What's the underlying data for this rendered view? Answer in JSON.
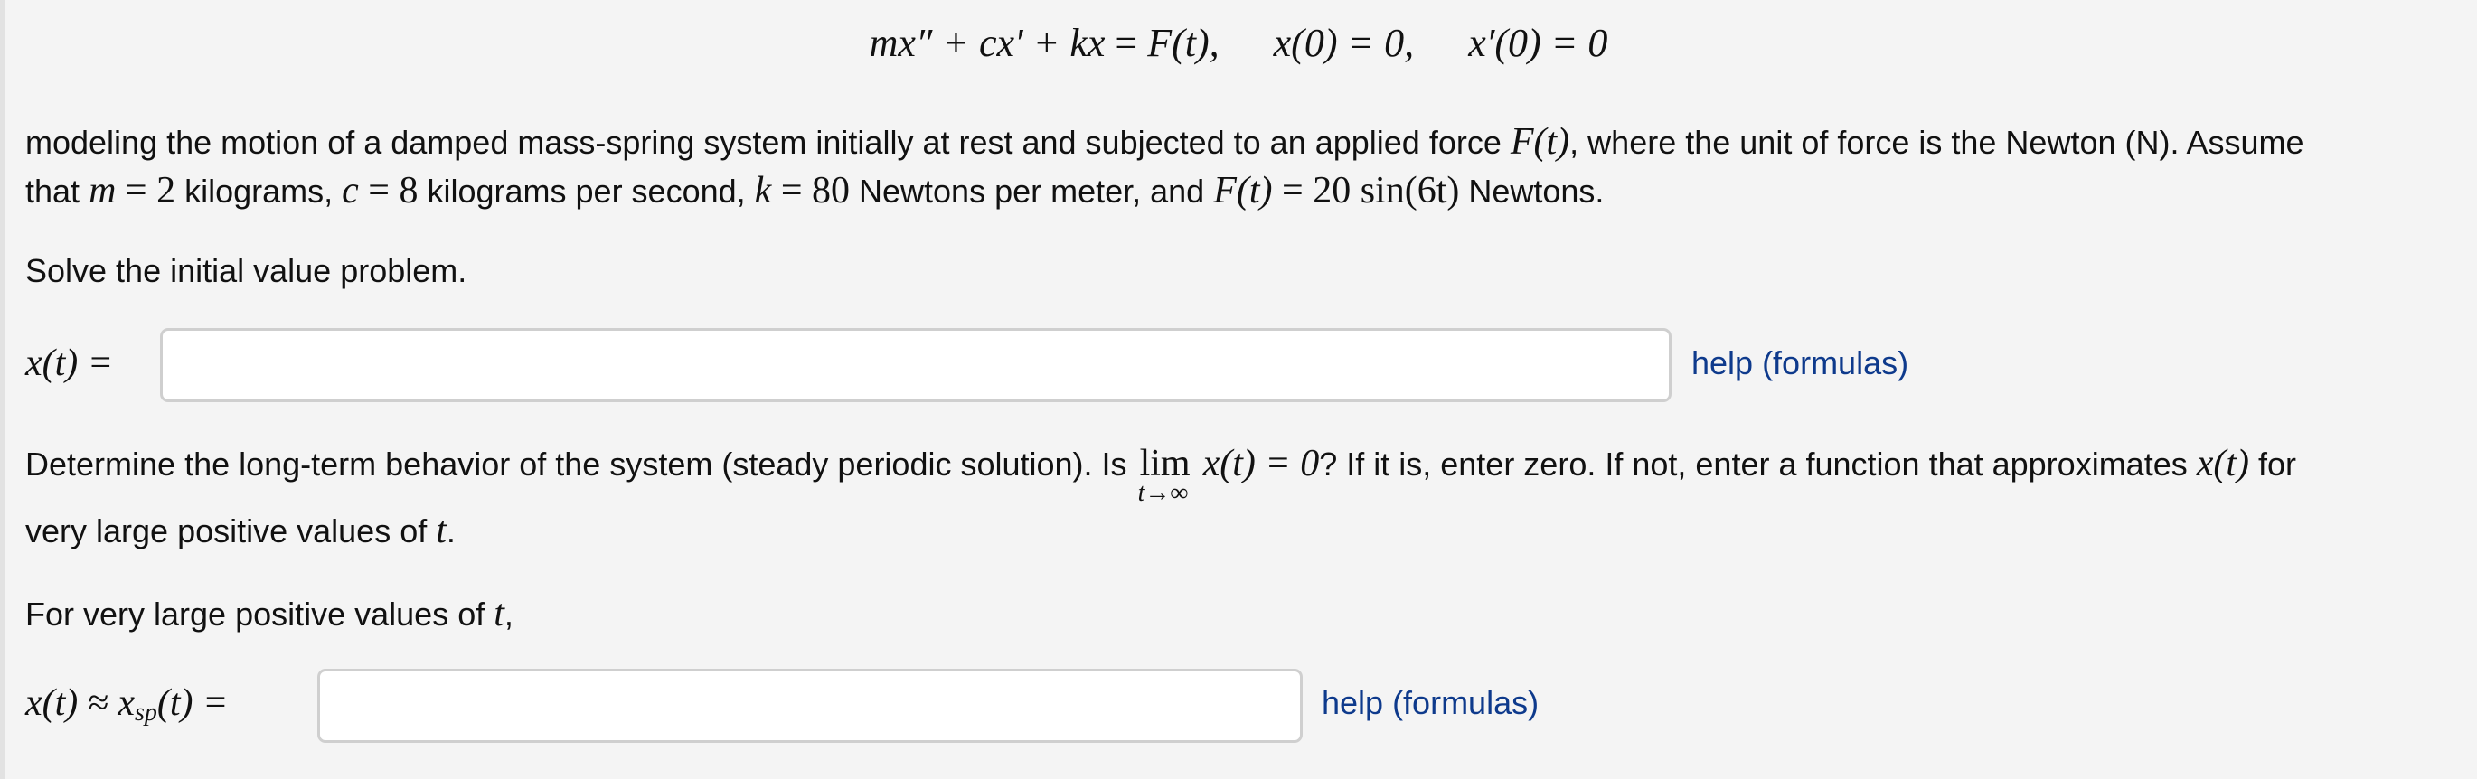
{
  "equation": {
    "lhs": "mx″ + cx′ + kx",
    "rhs": "F(t),",
    "ic1": "x(0) = 0,",
    "ic2": "x′(0) = 0"
  },
  "intro": {
    "line1_a": "modeling the motion of a damped mass-spring system initially at rest and subjected to an applied force ",
    "line1_math": "F(t)",
    "line1_b": ", where the unit of force is the Newton (N). Assume",
    "line2_a": "that ",
    "m_sym": "m",
    "eq": " = ",
    "m_val": "2",
    "line2_b": " kilograms, ",
    "c_sym": "c",
    "c_val": "8",
    "line2_c": " kilograms per second, ",
    "k_sym": "k",
    "k_val": "80",
    "line2_d": " Newtons per meter, and ",
    "F_sym": "F(t)",
    "F_val": "20 sin(6t)",
    "line2_e": " Newtons."
  },
  "solve_prompt": "Solve the initial value problem.",
  "answer1": {
    "label": "x(t) =",
    "value": "",
    "placeholder": "",
    "help_link": "help (formulas)"
  },
  "longterm": {
    "text_a": "Determine the long-term behavior of the system (steady periodic solution). Is ",
    "lim": "lim",
    "lim_sub": "t→∞",
    "lim_expr": "x(t) = 0",
    "text_b": "? If it is, enter zero. If not, enter a function that approximates ",
    "x_expr": "x(t)",
    "text_c": " for",
    "line2_a": "very large positive values of ",
    "t_sym": "t",
    "line2_b": "."
  },
  "large_t_prompt": {
    "text": "For very large positive values of ",
    "t_sym": "t",
    "tail": ","
  },
  "answer2": {
    "label_a": "x(t) ≈ x",
    "label_sub": "sp",
    "label_b": "(t) =",
    "value": "",
    "placeholder": "",
    "help_link": "help (formulas)"
  },
  "colors": {
    "background": "#f4f4f4",
    "link": "#0e3a8c",
    "input_border": "#cfcfcf"
  }
}
